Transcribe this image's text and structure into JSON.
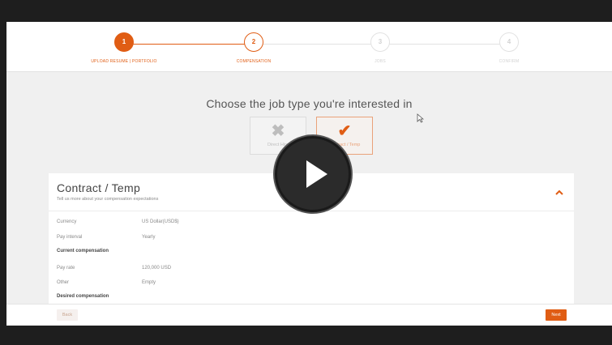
{
  "wizard": {
    "steps": [
      {
        "number": "1",
        "label": "UPLOAD RESUME | PORTFOLIO"
      },
      {
        "number": "2",
        "label": "COMPENSATION"
      },
      {
        "number": "3",
        "label": "JOBS"
      },
      {
        "number": "4",
        "label": "CONFIRM"
      }
    ],
    "accent_color": "#e05d14"
  },
  "job_type": {
    "question": "Choose the job type you're interested in",
    "options": [
      {
        "label": "Direct Hire",
        "icon": "x-icon",
        "selected": false
      },
      {
        "label": "Contract / Temp",
        "icon": "check-icon",
        "selected": true
      }
    ]
  },
  "panel": {
    "title": "Contract / Temp",
    "subtitle": "Tell us more about your compensation expectations",
    "rows": [
      {
        "label": "Currency",
        "value": "US Dollar(USD$)"
      },
      {
        "label": "Pay interval",
        "value": "Yearly"
      },
      {
        "label": "Current compensation",
        "value": ""
      },
      {
        "label": "Pay rate",
        "value": "120,000 USD"
      },
      {
        "label": "Other",
        "value": "Empty"
      },
      {
        "label": "Desired compensation",
        "value": ""
      }
    ]
  },
  "footer": {
    "back_label": "Back",
    "next_label": "Next"
  },
  "video": {
    "play_icon": "play-icon"
  }
}
